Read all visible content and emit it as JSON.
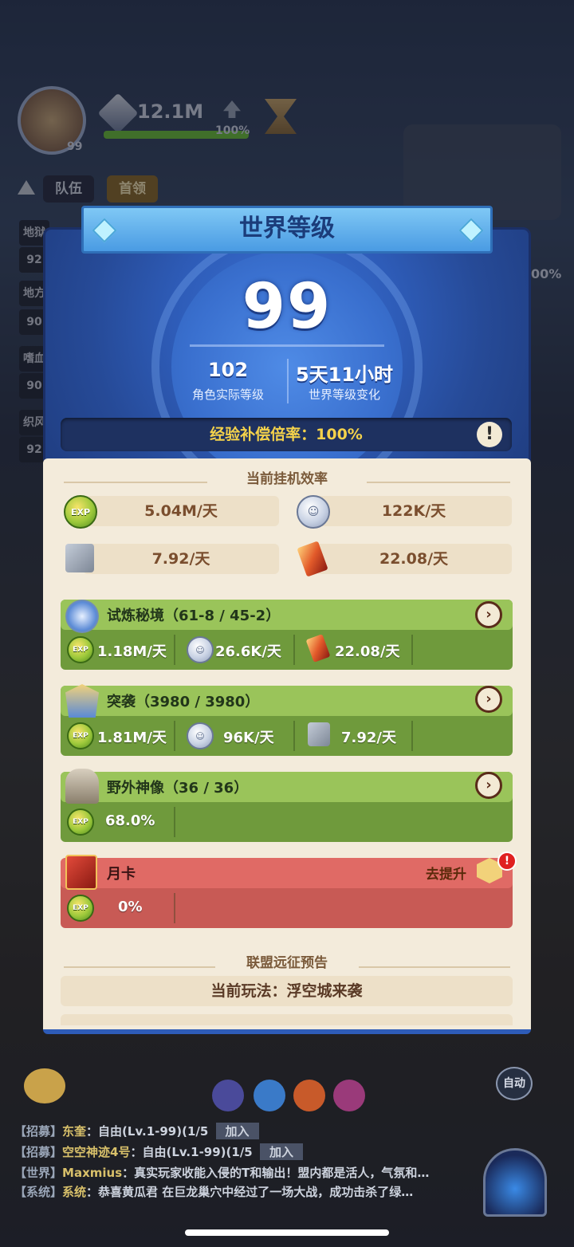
{
  "hud": {
    "level": "99",
    "power": "12.1M",
    "progress": "100%",
    "tabs": [
      "队伍",
      "首领"
    ],
    "side_labels": [
      "地狱",
      "92",
      "地方",
      "90",
      "嗜血",
      "90",
      "织风",
      "92"
    ],
    "right_pct": "00%"
  },
  "panel": {
    "title": "世界等级",
    "world_level": "99",
    "actual_level_value": "102",
    "actual_level_label": "角色实际等级",
    "change_value": "5天11小时",
    "change_label": "世界等级变化",
    "exp_rate": "经验补偿倍率：100%",
    "alert_symbol": "!"
  },
  "efficiency": {
    "title": "当前挂机效率",
    "items": [
      {
        "icon": "exp-icon",
        "value": "5.04M/天"
      },
      {
        "icon": "silver-coin-icon",
        "value": "122K/天"
      },
      {
        "icon": "stone-icon",
        "value": "7.92/天"
      },
      {
        "icon": "crystal-icon",
        "value": "22.08/天"
      }
    ]
  },
  "sources": [
    {
      "title": "试炼秘境（61-8 / 45-2）",
      "cells": [
        "1.18M/天",
        "26.6K/天",
        "22.08/天"
      ]
    },
    {
      "title": "突袭（3980 / 3980）",
      "cells": [
        "1.81M/天",
        "96K/天",
        "7.92/天"
      ]
    },
    {
      "title": "野外神像（36 / 36）",
      "cells": [
        "68.0%"
      ]
    },
    {
      "title": "月卡",
      "action": "去提升",
      "cells": [
        "0%"
      ]
    }
  ],
  "alliance": {
    "title": "联盟远征预告",
    "current": "当前玩法：浮空城来袭"
  },
  "auto_label": "自动",
  "chat": [
    {
      "tag": "【招募】",
      "name": "东奎",
      "text": "：自由(Lv.1-99)(1/5",
      "btn": "加入"
    },
    {
      "tag": "【招募】",
      "name": "空空神迹4号",
      "text": "：自由(Lv.1-99)(1/5",
      "btn": "加入"
    },
    {
      "tag": "【世界】",
      "name": "Maxmius",
      "text": "：真实玩家收能入侵的T和输出！盟内都是活人，气氛和…"
    },
    {
      "tag": "【系统】",
      "name": "系统",
      "text": "：恭喜黄瓜君 在巨龙巢穴中经过了一场大战，成功击杀了绿…"
    }
  ],
  "colors": {
    "accent_blue": "#2e5cb8",
    "green_card": "#9ac45a",
    "red_card": "#e06a65",
    "gold_text": "#f4d24b"
  }
}
